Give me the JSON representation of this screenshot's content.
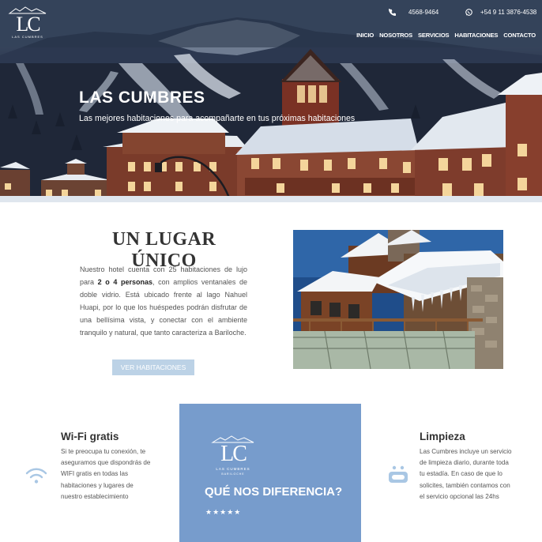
{
  "brand": {
    "logo_letters": "LC",
    "logo_name": "LAS CUMBRES",
    "logo_tagline": "BARILOCHE"
  },
  "contact": {
    "phone": "4568-9464",
    "whatsapp": "+54 9 11 3876-4538"
  },
  "nav": {
    "items": [
      "INICIO",
      "NOSOTROS",
      "SERVICIOS",
      "HABITACIONES",
      "CONTACTO"
    ]
  },
  "hero": {
    "title": "LAS CUMBRES",
    "subtitle": "Las mejores habitaciones para acompañarte en tus próximas habitaciones"
  },
  "intro": {
    "title": "UN LUGAR ÚNICO",
    "text_before": "Nuestro hotel cuenta con 25 habitaciones de lujo para ",
    "text_bold": "2 o 4 personas",
    "text_after": ", con amplios ventanales de doble vidrio. Está ubicado frente al lago Nahuel Huapi, por lo que los huéspedes podrán disfrutar de una bellísima vista, y conectar con el ambiente tranquilo y natural, que tanto caracteriza a Bariloche.",
    "button": "VER HABITACIONES"
  },
  "features": {
    "wifi_title": "Wi-Fi gratis",
    "wifi_text": "Si te preocupa tu conexión, te aseguramos que dispondrás de WIFI gratis en todas las habitaciones y lugares de nuestro establecimiento",
    "clean_title": "Limpieza",
    "clean_text": "Las Cumbres incluye un servicio de limpieza diario, durante toda tu estadía. En caso de que lo solicites, también contamos con el servicio opcional las 24hs",
    "diff_title": "QUÉ NOS DIFERENCIA?",
    "stars": "★★★★★"
  },
  "colors": {
    "accent": "#779ccc",
    "button": "#bcd2e6",
    "icon": "#a9c7e4"
  }
}
